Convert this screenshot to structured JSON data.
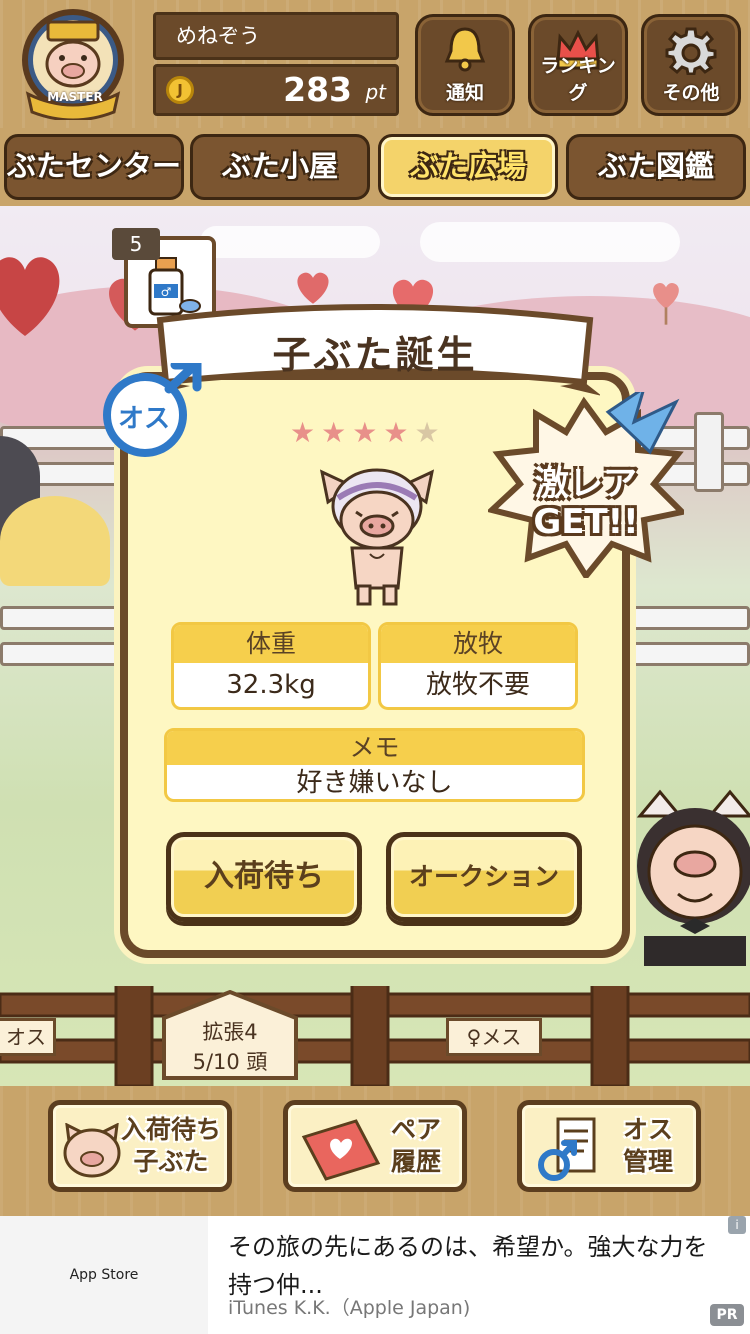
{
  "header": {
    "badge_text": "MASTER",
    "username": "めねぞう",
    "coin_symbol": "J",
    "points": "283",
    "points_unit": "pt",
    "buttons": [
      {
        "label": "通知",
        "icon": "bell-icon"
      },
      {
        "label": "ランキング",
        "icon": "crown-icon"
      },
      {
        "label": "その他",
        "icon": "gear-icon"
      }
    ]
  },
  "nav": {
    "tabs": [
      {
        "label": "ぶたセンター",
        "active": false
      },
      {
        "label": "ぶた小屋",
        "active": false
      },
      {
        "label": "ぶた広場",
        "active": true
      },
      {
        "label": "ぶた図鑑",
        "active": false
      }
    ]
  },
  "scene": {
    "item_count": "5",
    "sign_left": "オス",
    "sign_right": "♀メス",
    "expansion_title": "拡張4",
    "expansion_count": "5/10 頭"
  },
  "modal": {
    "title": "子ぶた誕生",
    "gender_label": "オス",
    "rarity_stars": 4,
    "rarity_max": 5,
    "rare_badge_line1": "激レア",
    "rare_badge_line2": "GET!!",
    "weight_label": "体重",
    "weight_value": "32.3kg",
    "grazing_label": "放牧",
    "grazing_value": "放牧不要",
    "memo_label": "メモ",
    "memo_value": "好き嫌いなし",
    "waiting_button": "入荷待ち",
    "auction_button": "オークション"
  },
  "bottom": {
    "buttons": [
      {
        "line1": "入荷待ち",
        "line2": "子ぶた",
        "icon": "pig-face-icon"
      },
      {
        "line1": "ペア",
        "line2": "履歴",
        "icon": "book-heart-icon"
      },
      {
        "line1": "オス",
        "line2": "管理",
        "icon": "male-document-icon"
      }
    ]
  },
  "ad": {
    "store": "App Store",
    "text": "その旅の先にあるのは、希望か。強大な力を持つ仲...",
    "sponsor": "iTunes K.K.（Apple Japan)",
    "info": "i",
    "pr": "PR"
  },
  "colors": {
    "wood": "#c8a46a",
    "dark_wood": "#6b4a2a",
    "cream": "#fef7c2",
    "gold": "#f6cf4c",
    "male_blue": "#2f79c8",
    "star_on": "#e8908a",
    "star_off": "#d9c7a4"
  }
}
